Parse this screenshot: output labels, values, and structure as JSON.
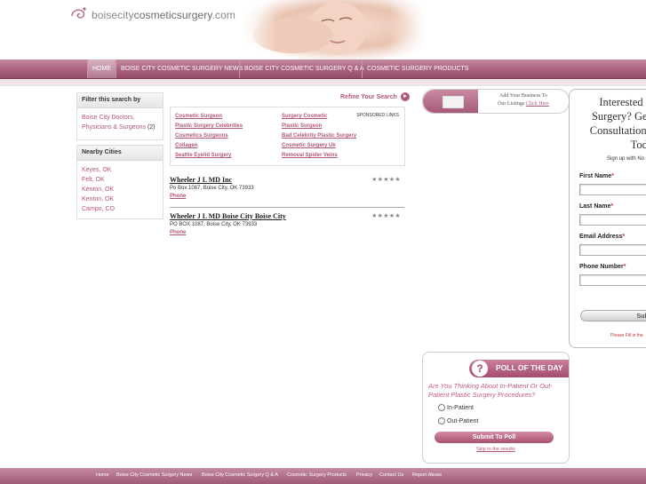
{
  "site": {
    "logo_text_a": "boisecity",
    "logo_text_b": "cosmeticsurgery",
    "logo_text_c": ".com"
  },
  "nav": {
    "items": [
      {
        "label": "HOME",
        "active": true
      },
      {
        "label": "BOISE CITY COSMETIC SURGERY NEWS",
        "active": false
      },
      {
        "label": "BOISE CITY COSMETIC SURGERY Q & A",
        "active": false
      },
      {
        "label": "COSMETIC SURGERY PRODUCTS",
        "active": false
      }
    ]
  },
  "sidebar": {
    "filter_title": "Filter this search by",
    "filter_link": "Boise City Doctors, Physicians & Surgeons",
    "filter_count": "(2)",
    "nearby_title": "Nearby Cities",
    "nearby_cities": [
      "Keyes, OK",
      "Felt, OK",
      "Kenton, OK",
      "Kenton, OK",
      "Campo, CO"
    ]
  },
  "results": {
    "refine_label": "Refine Your Search",
    "sponsored_label": "SPONSORED LINKS",
    "sponsored_col1": [
      "Cosmetic Surgeon",
      "Plastic Surgery Celebrities",
      "Cosmetics Surgeons",
      "Collagen",
      "Seattle Eyelid Surgery"
    ],
    "sponsored_col2": [
      "Surgery Cosmetic",
      "Plastic Surgeon",
      "Bad Celebrity Plastic Surgery",
      "Cosmetic Surgery Uk",
      "Removal Spider Veins"
    ],
    "listings": [
      {
        "name": "Wheeler J L MD Inc",
        "address": "Po Box 1087, Boise City, OK 73933",
        "phone_label": "Phone",
        "rating": "★★★★★"
      },
      {
        "name": "Wheeler J L MD Boise City Boise City",
        "address": "PO BOX 1087, Boise City, OK 73933",
        "phone_label": "Phone",
        "rating": "★★★★★"
      }
    ]
  },
  "add_business": {
    "line1": "Add Your Business To",
    "line2": "Our Listings",
    "click": "Click Here"
  },
  "consult_form": {
    "headline_1": "Interested",
    "headline_2": "Surgery? Get",
    "headline_3": "Consultation i",
    "headline_4": "Toda",
    "sub": "Sign up with No",
    "first_name": "First Name",
    "last_name": "Last Name",
    "email": "Email Address",
    "phone": "Phone Number",
    "required_mark": "*",
    "submit": "Subm",
    "note": "Please Fill in the"
  },
  "poll": {
    "title": "POLL OF THE DAY",
    "question": "Are You Thinking About In-Patient Or Out-Patient Plastic Surgery Procedures?",
    "options": [
      "In-Patient",
      "Out-Patient"
    ],
    "submit": "Submit To Poll",
    "skip": "Skip to the results"
  },
  "footer": {
    "links": [
      "Home",
      "Boise City Cosmetic Surgery News",
      "Boise City Cosmetic Surgery Q & A",
      "Cosmetic Surgery Products",
      "Privacy",
      "Contact Us",
      "Report Abuse"
    ]
  },
  "colors": {
    "accent": "#b3557a",
    "nav_bg": "#a8607c"
  }
}
